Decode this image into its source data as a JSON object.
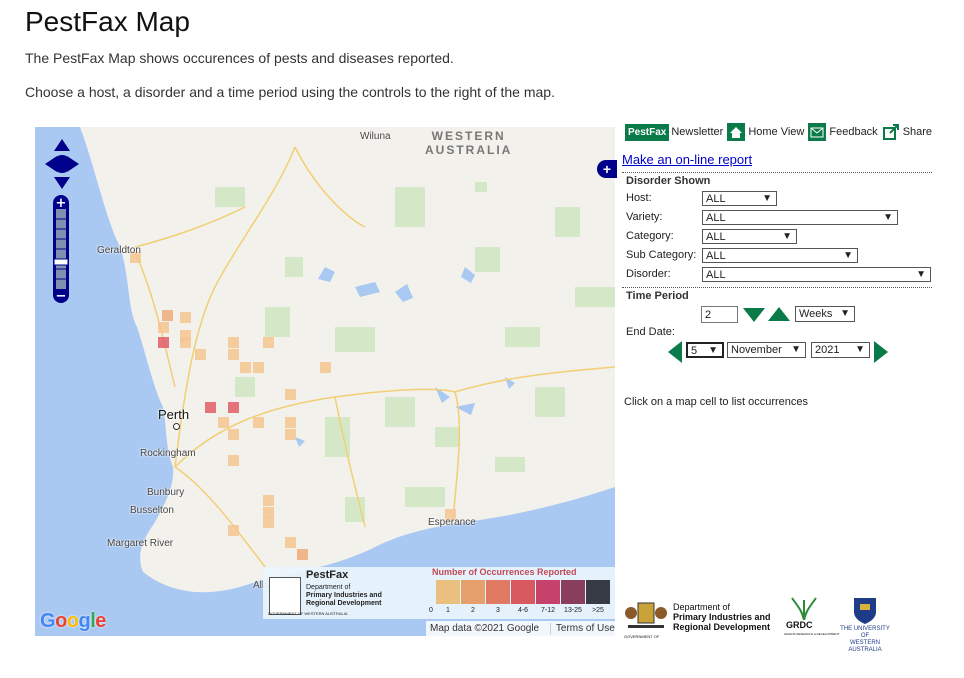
{
  "page": {
    "title": "PestFax Map",
    "intro1": "The PestFax Map shows occurences of pests and diseases reported.",
    "intro2": "Choose a host, a disorder and a time period using the controls to the right of the map."
  },
  "map": {
    "region_label_1": "WESTERN",
    "region_label_2": "AUSTRALIA",
    "towns": {
      "wiluna": "Wiluna",
      "geraldton": "Geraldton",
      "perth": "Perth",
      "rockingham": "Rockingham",
      "bunbury": "Bunbury",
      "busselton": "Busselton",
      "margaret_river": "Margaret River",
      "esperance": "Esperance",
      "albany": "Alba"
    },
    "google_logo": "Google",
    "map_data": "Map data ©2021 Google",
    "terms": "Terms of Use",
    "legend": {
      "title": "PestFax",
      "org_line1": "Department of",
      "org_line2": "Primary Industries and",
      "org_line3": "Regional Development",
      "gov": "GOVERNMENT OF WESTERN AUSTRALIA",
      "scale_title": "Number of Occurrences Reported",
      "bins": [
        "0",
        "1",
        "2",
        "3",
        "4-6",
        "7-12",
        "13-25",
        ">25"
      ],
      "colors": [
        "#e9c07f",
        "#e6a06c",
        "#e07a63",
        "#d85a60",
        "#c6426a",
        "#8a3e5e",
        "#363b46"
      ]
    },
    "cell_colors": {
      "one": "#f4c590",
      "two": "#eeaa7a",
      "four": "#e25e66"
    }
  },
  "toolbar": {
    "logo": "PestFax",
    "newsletter": "Newsletter",
    "home": "Home View",
    "feedback": "Feedback",
    "share": "Share"
  },
  "report_link": "Make an on-line report",
  "disorder": {
    "heading": "Disorder Shown",
    "host_label": "Host:",
    "host_value": "ALL",
    "variety_label": "Variety:",
    "variety_value": "ALL",
    "category_label": "Category:",
    "category_value": "ALL",
    "subcategory_label": "Sub Category:",
    "subcategory_value": "ALL",
    "disorder_label": "Disorder:",
    "disorder_value": "ALL"
  },
  "time": {
    "heading": "Time Period",
    "amount": "2",
    "unit": "Weeks",
    "end_date_label": "End Date:",
    "day": "5",
    "month": "November",
    "year": "2021"
  },
  "hint": "Click on a map cell to list occurrences",
  "footer": {
    "dpird_line1": "Department of",
    "dpird_line2": "Primary Industries and",
    "dpird_line3": "Regional Development",
    "gov": "GOVERNMENT OF",
    "grdc": "GRDC",
    "grdc_sub": "GRAINS RESEARCH & DEVELOPMENT",
    "uwa_line1": "THE UNIVERSITY OF",
    "uwa_line2": "WESTERN AUSTRALIA"
  },
  "colors": {
    "accent_green": "#0a7a48",
    "nav_blue": "#00008b",
    "link_blue": "#0000cc"
  }
}
